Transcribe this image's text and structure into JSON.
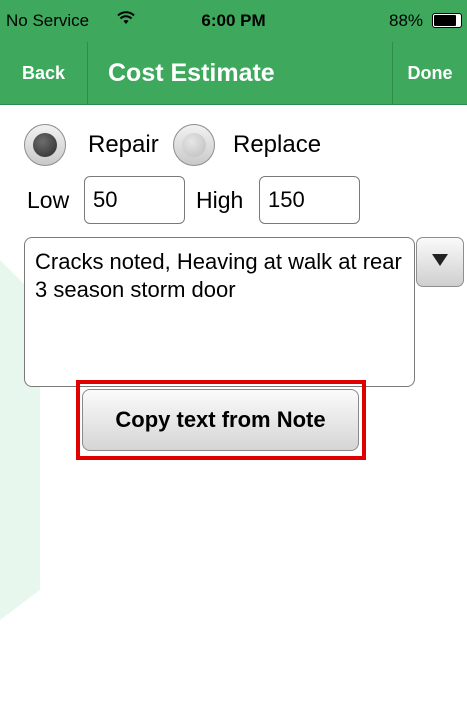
{
  "status_bar": {
    "carrier": "No Service",
    "time": "6:00 PM",
    "battery_percent": "88%",
    "battery_level": 0.88
  },
  "nav": {
    "back_label": "Back",
    "title": "Cost Estimate",
    "done_label": "Done"
  },
  "repair_type": {
    "options": [
      {
        "label": "Repair",
        "selected": true
      },
      {
        "label": "Replace",
        "selected": false
      }
    ]
  },
  "range": {
    "low_label": "Low",
    "low_value": "50",
    "high_label": "High",
    "high_value": "150"
  },
  "notes": {
    "text": "Cracks noted, Heaving at walk at rear 3 season storm door"
  },
  "actions": {
    "copy_label": "Copy text from Note"
  },
  "colors": {
    "nav_green": "#3ea95d",
    "highlight_red": "#e00000"
  }
}
